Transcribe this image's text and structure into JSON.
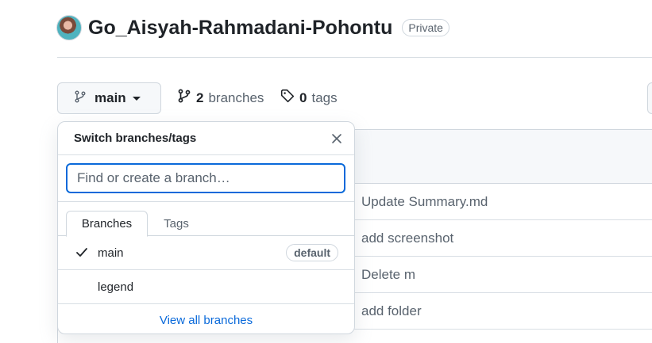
{
  "repo": {
    "name": "Go_Aisyah-Rahmadani-Pohontu",
    "visibility": "Private"
  },
  "toolbar": {
    "branch_label": "main",
    "branches_count": "2",
    "branches_label": "branches",
    "tags_count": "0",
    "tags_label": "tags"
  },
  "commits": [
    {
      "message": "Update Summary.md"
    },
    {
      "message": "add screenshot"
    },
    {
      "message": "Delete m"
    },
    {
      "message": "add folder"
    }
  ],
  "dropdown": {
    "title": "Switch branches/tags",
    "filter_placeholder": "Find or create a branch…",
    "tabs": [
      {
        "label": "Branches",
        "active": true
      },
      {
        "label": "Tags",
        "active": false
      }
    ],
    "branches": [
      {
        "name": "main",
        "selected": true,
        "badge": "default"
      },
      {
        "name": "legend",
        "selected": false,
        "badge": ""
      }
    ],
    "footer_link": "View all branches"
  },
  "icons": {
    "branch": "git-branch-icon",
    "tag": "tag-icon",
    "close": "x-icon",
    "check": "check-icon",
    "caret": "triangle-down-icon"
  },
  "colors": {
    "accent": "#0969da",
    "border": "#d0d7de",
    "muted_text": "#59636e"
  }
}
